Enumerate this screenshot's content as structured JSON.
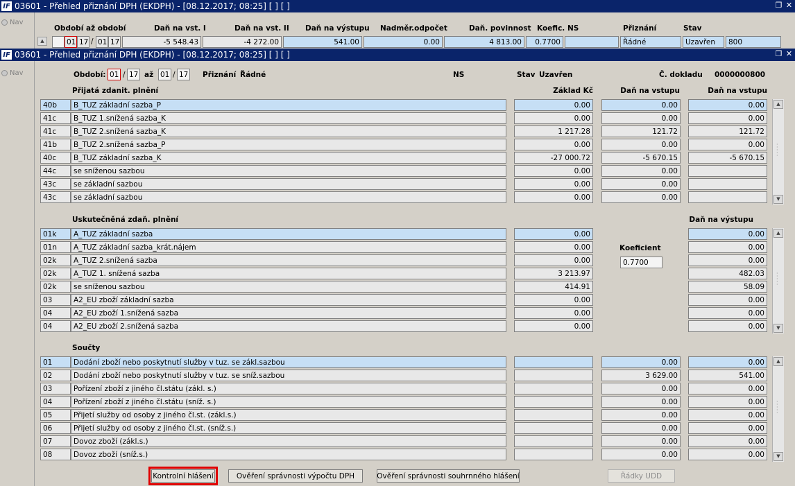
{
  "window1": {
    "title": "03601 - Přehled přiznání DPH (EKDPH) - [08.12.2017; 08:25]  [ ]  [ ]",
    "nav": "Nav",
    "headers": [
      "Období až období",
      "Daň na vst. I",
      "Daň na vst. II",
      "Daň na výstupu",
      "Nadměr.odpočet",
      "Daň. povinnost",
      "Koefic. NS",
      "Přiznání",
      "Stav"
    ],
    "from_month": "01",
    "from_year": "17",
    "to_month": "01",
    "to_year": "17",
    "dan_vst1": "-5 548.43",
    "dan_vst2": "-4 272.00",
    "dan_vystupu": "541.00",
    "nadmer": "0.00",
    "povinnost": "4 813.00",
    "koef": "0.7700",
    "ns": "",
    "priznani": "Řádné",
    "stav": "Uzavřen",
    "cislo": "800"
  },
  "window2": {
    "title": "03601 - Přehled přiznání DPH (EKDPH) - [08.12.2017; 08:25]  [ ]  [ ]",
    "nav": "Nav",
    "header": {
      "obdobi_label": "Období:",
      "from_month": "01",
      "from_year": "17",
      "az_label": "až",
      "to_month": "01",
      "to_year": "17",
      "priznani_label": "Přiznání",
      "priznani_value": "Řádné",
      "ns_label": "NS",
      "stav_label": "Stav",
      "stav_value": "Uzavřen",
      "doklad_label": "Č. dokladu",
      "doklad_value": "0000000800"
    },
    "section1": {
      "title": "Přijatá zdanit. plnění",
      "col_zaklad": "Základ Kč",
      "col_vstup1": "Daň na vstupu",
      "col_vstup2": "Daň na vstupu",
      "rows": [
        {
          "code": "40b",
          "name": "B_TUZ základní sazba_P",
          "zaklad": "0.00",
          "vstup1": "0.00",
          "vstup2": "0.00"
        },
        {
          "code": "41c",
          "name": "B_TUZ 1.snížená sazba_K",
          "zaklad": "0.00",
          "vstup1": "0.00",
          "vstup2": "0.00"
        },
        {
          "code": "41c",
          "name": "B_TUZ 2.snížená sazba_K",
          "zaklad": "1 217.28",
          "vstup1": "121.72",
          "vstup2": "121.72"
        },
        {
          "code": "41b",
          "name": "B_TUZ 2.snížená sazba_P",
          "zaklad": "0.00",
          "vstup1": "0.00",
          "vstup2": "0.00"
        },
        {
          "code": "40c",
          "name": "B_TUZ základní sazba_K",
          "zaklad": "-27 000.72",
          "vstup1": "-5 670.15",
          "vstup2": "-5 670.15"
        },
        {
          "code": "44c",
          "name": "se sníženou sazbou",
          "zaklad": "0.00",
          "vstup1": "0.00",
          "vstup2": ""
        },
        {
          "code": "43c",
          "name": "se základní sazbou",
          "zaklad": "0.00",
          "vstup1": "0.00",
          "vstup2": ""
        },
        {
          "code": "43c",
          "name": "se základní sazbou",
          "zaklad": "0.00",
          "vstup1": "0.00",
          "vstup2": ""
        }
      ]
    },
    "section2": {
      "title": "Uskutečněná zdaň. plnění",
      "col_vystup": "Daň na výstupu",
      "koef_label": "Koeficient",
      "koef_value": "0.7700",
      "rows": [
        {
          "code": "01k",
          "name": "A_TUZ základní sazba",
          "zaklad": "0.00",
          "vystup": "0.00"
        },
        {
          "code": "01n",
          "name": "A_TUZ základní sazba_krát.nájem",
          "zaklad": "0.00",
          "vystup": "0.00"
        },
        {
          "code": "02k",
          "name": "A_TUZ 2.snížená sazba",
          "zaklad": "0.00",
          "vystup": "0.00"
        },
        {
          "code": "02k",
          "name": "A_TUZ 1. snížená sazba",
          "zaklad": "3 213.97",
          "vystup": "482.03"
        },
        {
          "code": "02k",
          "name": "se sníženou sazbou",
          "zaklad": "414.91",
          "vystup": "58.09"
        },
        {
          "code": "03",
          "name": "A2_EU zboží základní sazba",
          "zaklad": "0.00",
          "vystup": "0.00"
        },
        {
          "code": "04",
          "name": "A2_EU zboží 1.snížená sazba",
          "zaklad": "0.00",
          "vystup": "0.00"
        },
        {
          "code": "04",
          "name": "A2_EU zboží 2.snížená sazba",
          "zaklad": "0.00",
          "vystup": "0.00"
        }
      ]
    },
    "section3": {
      "title": "Součty",
      "rows": [
        {
          "code": "01",
          "name": "Dodání zboží nebo poskytnutí služby v tuz. se zákl.sazbou",
          "c1": "",
          "c2": "0.00",
          "c3": "0.00"
        },
        {
          "code": "02",
          "name": "Dodání zboží nebo poskytnutí služby v tuz. se sníž.sazbou",
          "c1": "",
          "c2": "3 629.00",
          "c3": "541.00"
        },
        {
          "code": "03",
          "name": "Pořízení zboží z jiného čl.státu (zákl. s.)",
          "c1": "",
          "c2": "0.00",
          "c3": "0.00"
        },
        {
          "code": "04",
          "name": "Pořízení zboží z jiného čl.státu (sníž. s.)",
          "c1": "",
          "c2": "0.00",
          "c3": "0.00"
        },
        {
          "code": "05",
          "name": "Přijetí služby od osoby z jiného čl.st. (zákl.s.)",
          "c1": "",
          "c2": "0.00",
          "c3": "0.00"
        },
        {
          "code": "06",
          "name": "Přijetí služby od osoby z jiného čl.st. (sníž.s.)",
          "c1": "",
          "c2": "0.00",
          "c3": "0.00"
        },
        {
          "code": "07",
          "name": "Dovoz zboží (zákl.s.)",
          "c1": "",
          "c2": "0.00",
          "c3": "0.00"
        },
        {
          "code": "08",
          "name": "Dovoz zboží (sníž.s.)",
          "c1": "",
          "c2": "0.00",
          "c3": "0.00"
        }
      ]
    },
    "buttons": {
      "kontrolni": "Kontrolní hlášení",
      "overeni_dph": "Ověření správnosti výpočtu DPH",
      "overeni_souhrn": "Ověření správnosti souhrnného hlášení",
      "radky_udd": "Řádky UDD"
    }
  },
  "colors": {
    "titlebar": "#0a246a",
    "selected_row": "#c6dff5",
    "focus_outline": "#e00000"
  }
}
